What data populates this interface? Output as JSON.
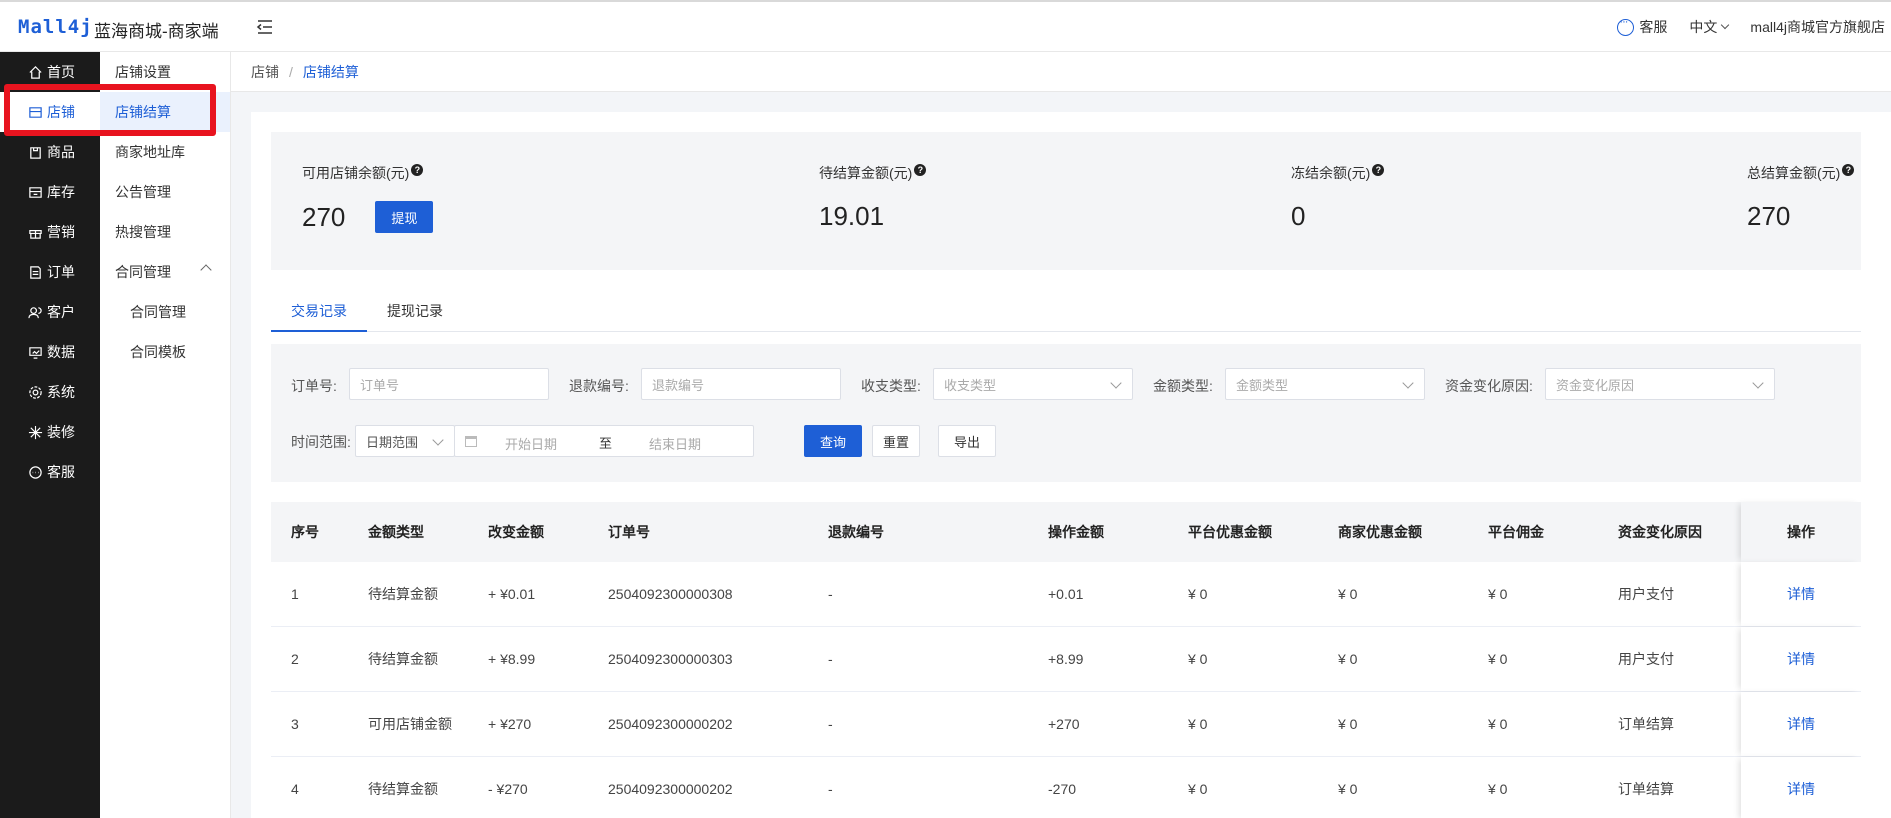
{
  "header": {
    "logo": "Mall4j",
    "app_title": "蓝海商城-商家端",
    "service_label": "客服",
    "language": "中文",
    "shop_name": "mall4j商城官方旗舰店"
  },
  "sidenav": {
    "items": [
      {
        "label": "首页",
        "icon": "home-icon"
      },
      {
        "label": "店铺",
        "icon": "shop-icon"
      },
      {
        "label": "商品",
        "icon": "product-icon"
      },
      {
        "label": "库存",
        "icon": "stock-icon"
      },
      {
        "label": "营销",
        "icon": "gift-icon"
      },
      {
        "label": "订单",
        "icon": "order-icon"
      },
      {
        "label": "客户",
        "icon": "users-icon"
      },
      {
        "label": "数据",
        "icon": "chart-icon"
      },
      {
        "label": "系统",
        "icon": "settings-icon"
      },
      {
        "label": "装修",
        "icon": "decorate-icon"
      },
      {
        "label": "客服",
        "icon": "chat-icon"
      }
    ]
  },
  "subnav": {
    "items": [
      {
        "label": "店铺设置"
      },
      {
        "label": "店铺结算"
      },
      {
        "label": "商家地址库"
      },
      {
        "label": "公告管理"
      },
      {
        "label": "热搜管理"
      },
      {
        "label": "合同管理"
      },
      {
        "label": "合同管理"
      },
      {
        "label": "合同模板"
      }
    ]
  },
  "breadcrumb": {
    "root": "店铺",
    "sep": "/",
    "current": "店铺结算"
  },
  "balance": {
    "available_label": "可用店铺余额(元)",
    "available_value": "270",
    "withdraw_btn": "提现",
    "pending_label": "待结算金额(元)",
    "pending_value": "19.01",
    "frozen_label": "冻结余额(元)",
    "frozen_value": "0",
    "total_label": "总结算金额(元)",
    "total_value": "270",
    "help_glyph": "?"
  },
  "tabs": [
    "交易记录",
    "提现记录"
  ],
  "filter": {
    "order_label": "订单号:",
    "order_placeholder": "订单号",
    "refund_label": "退款编号:",
    "refund_placeholder": "退款编号",
    "io_label": "收支类型:",
    "io_placeholder": "收支类型",
    "amount_type_label": "金额类型:",
    "amount_type_placeholder": "金额类型",
    "reason_label": "资金变化原因:",
    "reason_placeholder": "资金变化原因",
    "time_label": "时间范围:",
    "time_range_value": "日期范围",
    "start_placeholder": "开始日期",
    "to_text": "至",
    "end_placeholder": "结束日期",
    "search_btn": "查询",
    "reset_btn": "重置",
    "export_btn": "导出"
  },
  "table": {
    "headers": [
      "序号",
      "金额类型",
      "改变金额",
      "订单号",
      "退款编号",
      "操作金额",
      "平台优惠金额",
      "商家优惠金额",
      "平台佣金",
      "资金变化原因",
      "操作"
    ],
    "rows": [
      {
        "no": "1",
        "type": "待结算金额",
        "change": "+ ¥0.01",
        "order": "2504092300000308",
        "refund": "-",
        "op_amount": "+0.01",
        "platform_discount": "¥ 0",
        "merchant_discount": "¥ 0",
        "commission": "¥ 0",
        "reason": "用户支付",
        "action": "详情"
      },
      {
        "no": "2",
        "type": "待结算金额",
        "change": "+ ¥8.99",
        "order": "2504092300000303",
        "refund": "-",
        "op_amount": "+8.99",
        "platform_discount": "¥ 0",
        "merchant_discount": "¥ 0",
        "commission": "¥ 0",
        "reason": "用户支付",
        "action": "详情"
      },
      {
        "no": "3",
        "type": "可用店铺金额",
        "change": "+ ¥270",
        "order": "2504092300000202",
        "refund": "-",
        "op_amount": "+270",
        "platform_discount": "¥ 0",
        "merchant_discount": "¥ 0",
        "commission": "¥ 0",
        "reason": "订单结算",
        "action": "详情"
      },
      {
        "no": "4",
        "type": "待结算金额",
        "change": "- ¥270",
        "order": "2504092300000202",
        "refund": "-",
        "op_amount": "-270",
        "platform_discount": "¥ 0",
        "merchant_discount": "¥ 0",
        "commission": "¥ 0",
        "reason": "订单结算",
        "action": "详情"
      }
    ]
  }
}
